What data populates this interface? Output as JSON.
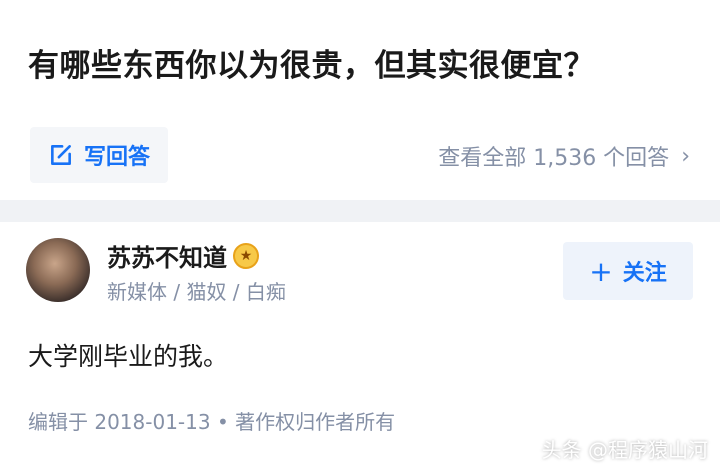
{
  "question": {
    "title": "有哪些东西你以为很贵，但其实很便宜？",
    "write_answer_label": "写回答",
    "view_all_label": "查看全部 1,536 个回答",
    "chevron": "›"
  },
  "answer": {
    "author_name": "苏苏不知道",
    "author_bio": "新媒体 / 猫奴 / 白痴",
    "follow_label": "关注",
    "follow_plus": "+",
    "content": "大学刚毕业的我。",
    "meta": "编辑于 2018-01-13 • 著作权归作者所有"
  },
  "watermark": "头条 @程序猿山河",
  "colors": {
    "accent": "#1772f6",
    "muted": "#8590a6",
    "divider": "#f0f2f5"
  },
  "icons": [
    "edit-icon",
    "chevron-right-icon",
    "avatar",
    "badge-icon",
    "plus-icon"
  ]
}
